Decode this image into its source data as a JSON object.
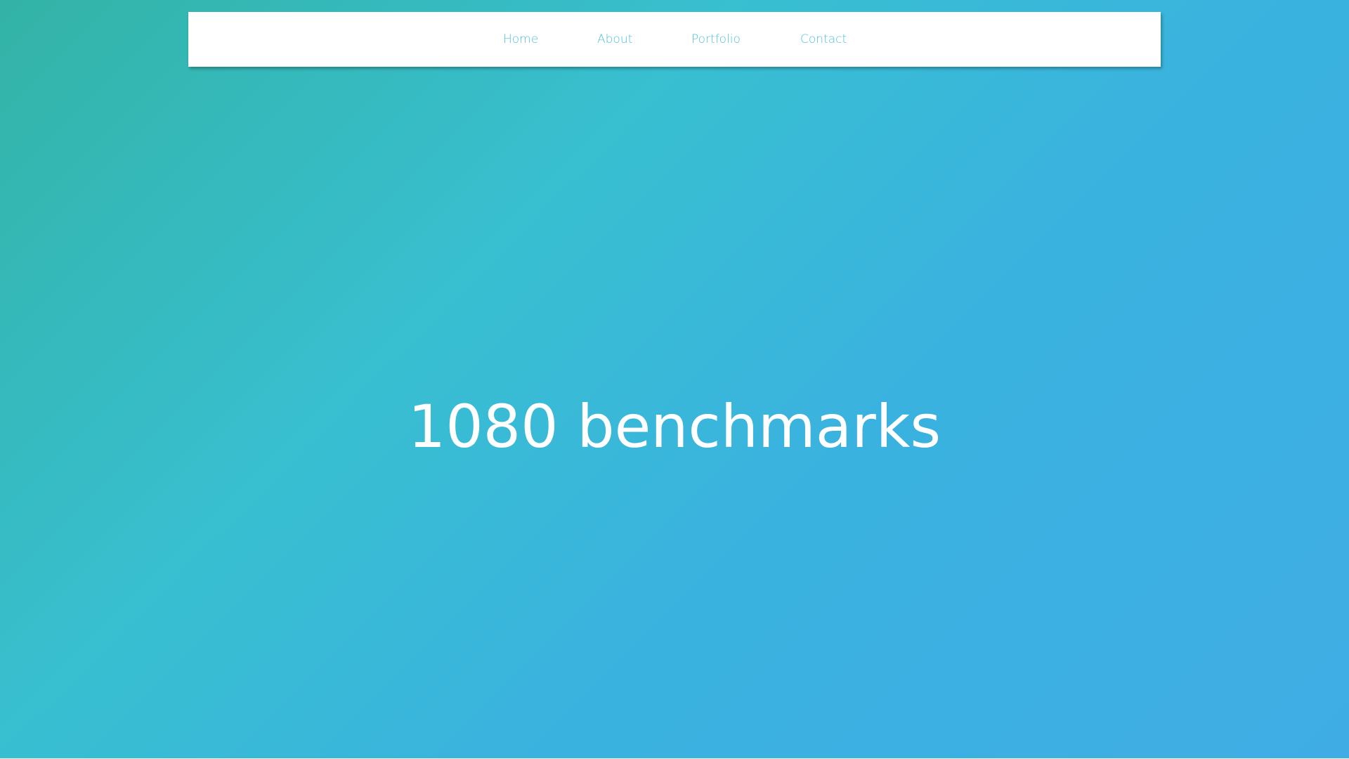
{
  "nav": {
    "items": [
      {
        "label": "Home"
      },
      {
        "label": "About"
      },
      {
        "label": "Portfolio"
      },
      {
        "label": "Contact"
      }
    ]
  },
  "hero": {
    "title": "1080 benchmarks"
  },
  "colors": {
    "gradient_start": "#33b3a6",
    "gradient_mid": "#38bfd0",
    "gradient_end": "#3fade4",
    "nav_background": "#ffffff",
    "nav_link": "#52c0dd",
    "title_text": "#ffffff"
  }
}
